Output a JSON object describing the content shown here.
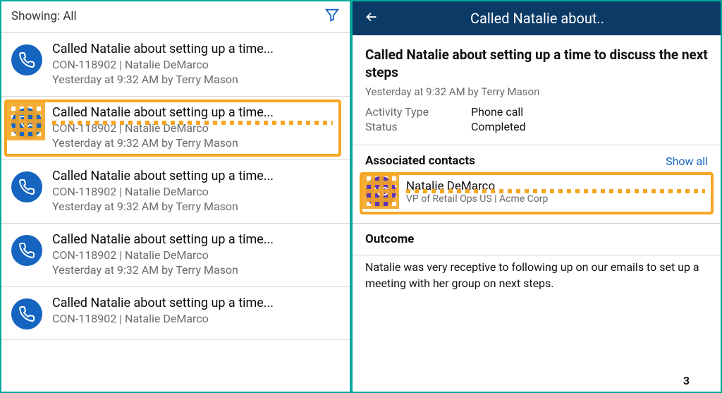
{
  "left": {
    "showing_label": "Showing: All",
    "items": [
      {
        "title": "Called Natalie about setting up a time...",
        "sub": "CON-118902 | Natalie DeMarco",
        "meta": "Yesterday at 9:32 AM by Terry Mason"
      },
      {
        "title": "Called Natalie about setting up a time...",
        "sub": "CON-118902 | Natalie DeMarco",
        "meta": "Yesterday at 9:32 AM by Terry Mason"
      },
      {
        "title": "Called Natalie about setting up a time...",
        "sub": "CON-118902 | Natalie DeMarco",
        "meta": "Yesterday at 9:32 AM by Terry Mason"
      },
      {
        "title": "Called Natalie about setting up a time...",
        "sub": "CON-118902 | Natalie DeMarco",
        "meta": "Yesterday at 9:32 AM by Terry Mason"
      },
      {
        "title": "Called Natalie about setting up a time...",
        "sub": "CON-118902 | Natalie DeMarco",
        "meta": ""
      }
    ],
    "selected_index": 1
  },
  "right": {
    "header_title": "Called Natalie about..",
    "detail_title": "Called Natalie about setting up a time to discuss the next steps",
    "detail_meta": "Yesterday at 9:32 AM by Terry Mason",
    "activity_type_label": "Activity Type",
    "activity_type_value": "Phone call",
    "status_label": "Status",
    "status_value": "Completed",
    "contacts_heading": "Associated contacts",
    "show_all": "Show all",
    "contact": {
      "initials": "ND",
      "name": "Natalie DeMarco",
      "sub": "VP of Retail Ops US | Acme Corp"
    },
    "outcome_heading": "Outcome",
    "outcome_body": "Natalie was very receptive to following up on our emails to set up a meeting with her group on next steps.",
    "footer_num": "3"
  }
}
